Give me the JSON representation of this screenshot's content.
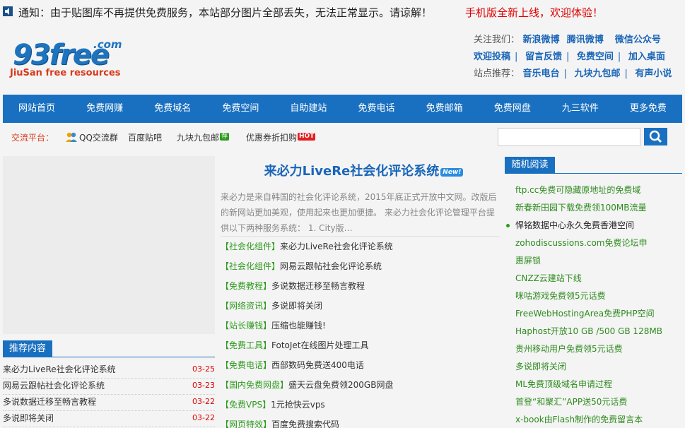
{
  "notice": {
    "text": "通知：由于贴图库不再提供免费服务，本站部分图片全部丢失，无法正常显示。请谅解！",
    "mobile": "手机版全新上线，欢迎体验！"
  },
  "logo": {
    "com": ".com",
    "main": "93free",
    "sub": "JiuSan free resources"
  },
  "header_links": {
    "row1_label": "关注我们：",
    "row1": [
      "新浪微博",
      "腾讯微博",
      "微信公众号"
    ],
    "row2": [
      "欢迎投稿",
      "留言反馈",
      "免费空间",
      "加入桌面"
    ],
    "row3_label": "站点推荐：",
    "row3": [
      "音乐电台",
      "九块九包邮",
      "有声小说"
    ]
  },
  "nav": [
    "网站首页",
    "免费网赚",
    "免费域名",
    "免费空间",
    "自助建站",
    "免费电话",
    "免费邮箱",
    "免费网盘",
    "九三软件",
    "更多免费"
  ],
  "subbar": {
    "label": "交流平台：",
    "qq": "QQ交流群",
    "baidu": "百度贴吧",
    "jiukuai": "九块九包邮",
    "jiukuai_badge": "荐",
    "youhui": "优惠券折扣购",
    "youhui_badge": "HOT"
  },
  "recommend": {
    "title": "推荐内容",
    "items": [
      {
        "title": "来必力LiveRe社会化评论系统",
        "date": "03-25"
      },
      {
        "title": "网易云跟帖社会化评论系统",
        "date": "03-23"
      },
      {
        "title": "多说数据迁移至畅言教程",
        "date": "03-22"
      },
      {
        "title": "多说即将关闭",
        "date": "03-22"
      }
    ]
  },
  "featured": {
    "title": "来必力LiveRe社会化评论系统",
    "badge": "New!",
    "desc": "来必力是来自韩国的社会化评论系统，2015年底正式开放中文网。改版后的新网站更加美观，使用起来也更加便捷。 来必力社会化评论管理平台提供以下两种服务系统： 1. City版…"
  },
  "articles": [
    {
      "cat": "【社会化组件】",
      "title": "来必力LiveRe社会化评论系统"
    },
    {
      "cat": "【社会化组件】",
      "title": "网易云跟帖社会化评论系统"
    },
    {
      "cat": "【免费教程】",
      "title": "多说数据迁移至畅言教程"
    },
    {
      "cat": "【网络资讯】",
      "title": "多说即将关闭"
    },
    {
      "cat": "【站长赚钱】",
      "title": "压缩也能赚钱!"
    },
    {
      "cat": "【免费工具】",
      "title": "FotoJet在线图片处理工具"
    },
    {
      "cat": "【免费电话】",
      "title": "西部数码免费送400电话"
    },
    {
      "cat": "【国内免费网盘】",
      "title": "盛天云盘免费领200GB网盘"
    },
    {
      "cat": "【免费VPS】",
      "title": "1元抢快云vps"
    },
    {
      "cat": "【网页特效】",
      "title": "百度免费搜索代码"
    }
  ],
  "random": {
    "title": "随机阅读",
    "items": [
      "ftp.cc免费可隐藏原地址的免费域",
      "新春新田园下载免费领100MB流量",
      "悍铭数据中心永久免费香港空间",
      "zohodiscussions.com免费论坛申",
      "惠屏锁",
      "CNZZ云建站下线",
      "咪咕游戏免费领5元话费",
      "FreeWebHostingArea免费PHP空间",
      "Haphost开放10 GB /500 GB 128MB",
      "贵州移动用户免费领5元话费",
      "多说即将关闭",
      "ML免费顶级域名申请过程",
      "首登“和聚汇”APP送50元话费",
      "x-book由Flash制作的免费留言本"
    ],
    "active_index": 2
  }
}
